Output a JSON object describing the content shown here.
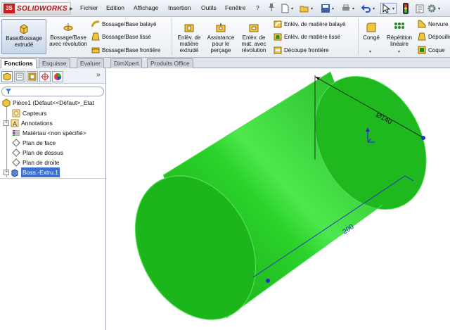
{
  "app": {
    "logo_text": "SOLIDWORKS",
    "logo_mark": "3S"
  },
  "menu": {
    "items": [
      "Fichier",
      "Edition",
      "Affichage",
      "Insertion",
      "Outils",
      "Fenêtre",
      "?"
    ]
  },
  "ribbon": {
    "extrude_boss": "Base/Bossage extrudé",
    "revolve_boss": "Bossage/Base avec révolution",
    "swept_boss": "Bossage/Base balayé",
    "lofted_boss": "Bossage/Base lissé",
    "boundary_boss": "Bossage/Base frontière",
    "extrude_cut": "Enlèv. de matière extrudé",
    "hole_wizard": "Assistance pour le perçage",
    "revolve_cut": "Enlèv. de mat. avec révolution",
    "swept_cut": "Enlèv. de matière balayé",
    "lofted_cut": "Enlèv. de matière lissé",
    "boundary_cut": "Découpe frontière",
    "fillet": "Congé",
    "linear_pattern": "Répétition linéaire",
    "rib": "Nervure",
    "draft": "Dépouille",
    "shell": "Coque"
  },
  "tabs": [
    "Fonctions",
    "Esquisse",
    "Evaluer",
    "DimXpert",
    "Produits Office"
  ],
  "tree": {
    "part": "Pièce1  (Défaut<<Défaut>_Etat",
    "items": [
      "Capteurs",
      "Annotations",
      "Matériau <non spécifié>",
      "Plan de face",
      "Plan de dessus",
      "Plan de droite",
      "Boss.-Extru.1"
    ]
  },
  "model": {
    "diameter_label": "Ø140",
    "length_label": "200",
    "body_color": "#22c322",
    "edge_color": "#48e048",
    "dimension_color": "#2a2ad0"
  },
  "colors": {
    "accent": "#3d6fd1",
    "logo_red": "#c61f1f"
  }
}
